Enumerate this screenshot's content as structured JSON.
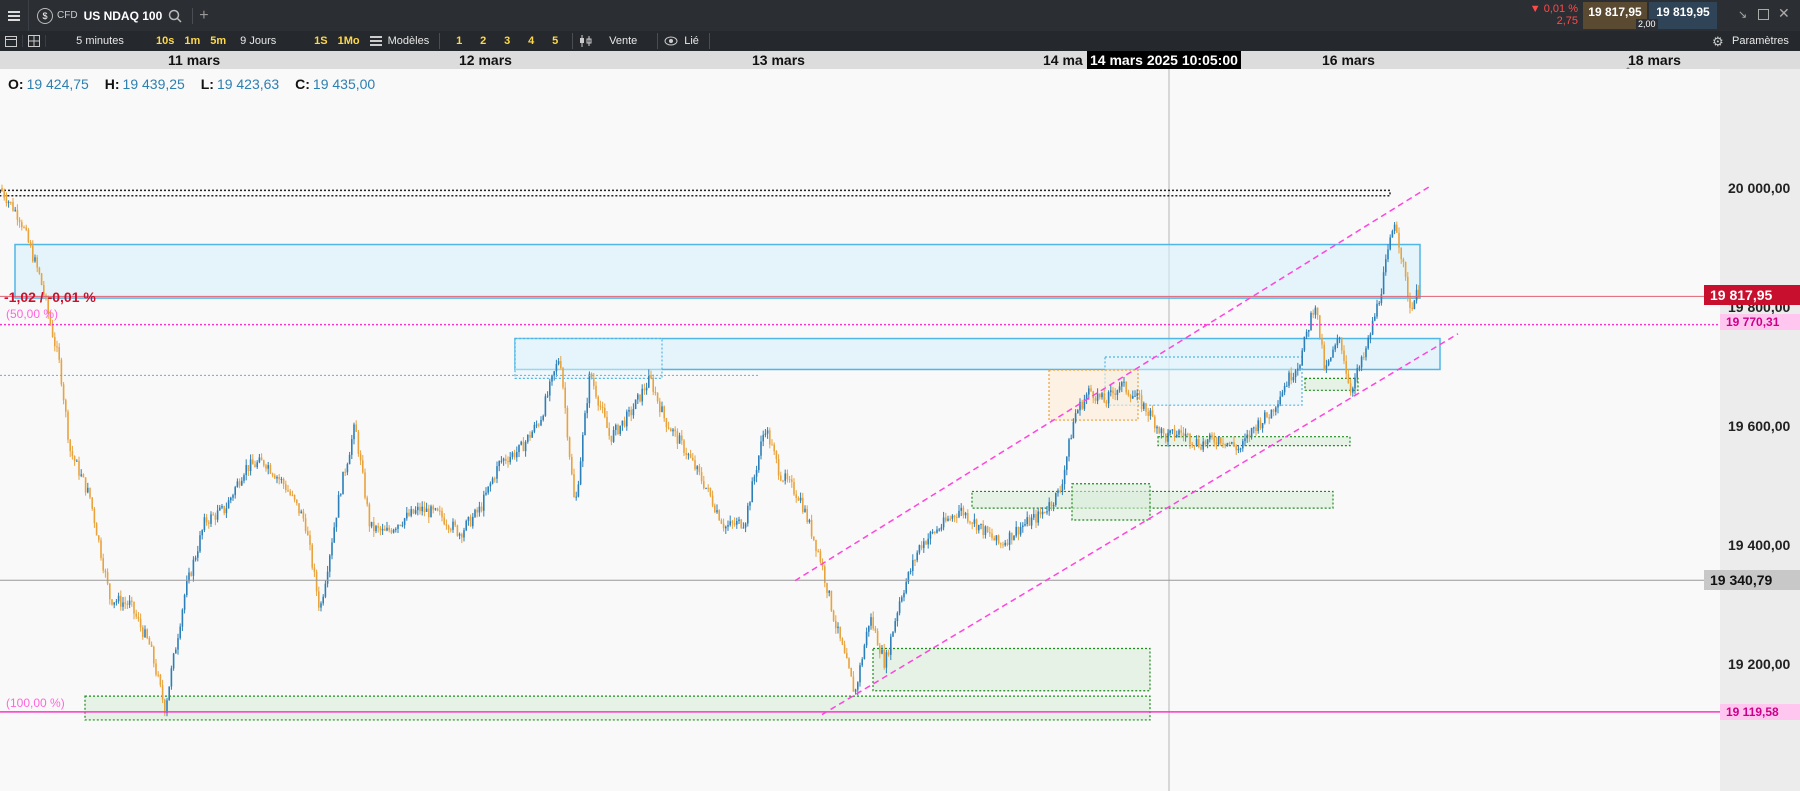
{
  "header": {
    "instrument_type": "CFD",
    "instrument_name": "US NDAQ 100",
    "change_pct": "▼ 0,01 %",
    "change_abs": "2,75",
    "bid": "19 817,95",
    "ask": "19 819,95",
    "spread": "2,00"
  },
  "toolbar": {
    "interval": "5 minutes",
    "intervals_short": [
      "10s",
      "1m",
      "5m"
    ],
    "range": "9 Jours",
    "intervals_long": [
      "1S",
      "1Mo"
    ],
    "models_label": "Modèles",
    "layouts": [
      "1",
      "2",
      "3",
      "4",
      "5"
    ],
    "side_label": "Vente",
    "link_label": "Lié",
    "settings_label": "Paramètres"
  },
  "ohlc": {
    "o_label": "O:",
    "o": "19 424,75",
    "h_label": "H:",
    "h": "19 439,25",
    "l_label": "L:",
    "l": "19 423,63",
    "c_label": "C:",
    "c": "19 435,00"
  },
  "crosshair_time": "14 mars 2025 10:05:00",
  "annotations": {
    "change_label": "-1,02 / -0,01 %",
    "fib_50": "(50,00 %)",
    "fib_100": "(100,00 %)"
  },
  "colors": {
    "up": "#2c7fb8",
    "down": "#e8a33d",
    "current_price_bg": "#c8102e",
    "fib_line": "#ff33cc",
    "zone_blue_border": "#4fb6e6",
    "zone_green_border": "#1e8c1e",
    "zone_orange_border": "#f0a030",
    "channel": "#ff44dd"
  },
  "chart_data": {
    "type": "candlestick",
    "timeframe": "5 minutes",
    "x_labels": [
      "11 mars",
      "12 mars",
      "13 mars",
      "14 ma",
      "16 mars",
      "18 mars"
    ],
    "y_ticks": [
      19200,
      19400,
      19600,
      19800,
      20000
    ],
    "y_tick_labels": [
      "19 200,00",
      "19 400,00",
      "19 600,00",
      "19 800,00",
      "20 000,00"
    ],
    "ylim": [
      18980,
      20100
    ],
    "current_price": {
      "value": 19817.95,
      "label": "19 817,95"
    },
    "fib_50": {
      "value": 19770.31,
      "label": "19 770,31"
    },
    "fib_100": {
      "value": 19119.58,
      "label": "19 119,58"
    },
    "hline_grey": {
      "value": 19340.79,
      "label": "19 340,79"
    },
    "black_zone": {
      "x": [
        0,
        1390
      ],
      "y": [
        19987,
        19996
      ]
    },
    "path_x": [
      0,
      20,
      40,
      60,
      70,
      90,
      110,
      130,
      150,
      165,
      185,
      205,
      225,
      245,
      265,
      285,
      305,
      320,
      340,
      355,
      370,
      385,
      400,
      420,
      440,
      460,
      480,
      500,
      520,
      540,
      560,
      575,
      590,
      610,
      630,
      650,
      665,
      685,
      705,
      725,
      745,
      765,
      780,
      800,
      820,
      835,
      855,
      870,
      885,
      900,
      920,
      940,
      960,
      980,
      1000,
      1020,
      1040,
      1060,
      1075,
      1090,
      1105,
      1120,
      1135,
      1150,
      1165,
      1180,
      1200,
      1220,
      1240,
      1255,
      1270,
      1285,
      1300,
      1315,
      1325,
      1340,
      1350,
      1365,
      1380,
      1395,
      1410,
      1420
    ],
    "path_y": [
      20000,
      19950,
      19850,
      19700,
      19560,
      19480,
      19310,
      19300,
      19230,
      19125,
      19320,
      19440,
      19460,
      19530,
      19540,
      19500,
      19440,
      19290,
      19490,
      19600,
      19430,
      19420,
      19440,
      19460,
      19450,
      19420,
      19460,
      19540,
      19560,
      19610,
      19720,
      19460,
      19690,
      19580,
      19620,
      19680,
      19610,
      19560,
      19500,
      19430,
      19440,
      19600,
      19520,
      19480,
      19380,
      19270,
      19150,
      19280,
      19200,
      19310,
      19400,
      19430,
      19460,
      19430,
      19400,
      19430,
      19450,
      19490,
      19620,
      19660,
      19640,
      19670,
      19650,
      19620,
      19580,
      19590,
      19570,
      19580,
      19560,
      19600,
      19620,
      19670,
      19710,
      19810,
      19690,
      19750,
      19660,
      19720,
      19820,
      19950,
      19800,
      19830
    ],
    "zones_blue": [
      {
        "x": [
          15,
          1420
        ],
        "y": [
          19815,
          19905
        ]
      },
      {
        "x": [
          515,
          1440
        ],
        "y": [
          19695,
          19747
        ]
      }
    ],
    "zones_blue_dotted": [
      {
        "x": [
          515,
          662
        ],
        "y": [
          19680,
          19747
        ]
      },
      {
        "x": [
          1105,
          1302
        ],
        "y": [
          19635,
          19716
        ]
      }
    ],
    "zones_green": [
      {
        "x": [
          85,
          1150
        ],
        "y": [
          19106,
          19146
        ]
      },
      {
        "x": [
          873,
          1150
        ],
        "y": [
          19155,
          19226
        ]
      },
      {
        "x": [
          972,
          1333
        ],
        "y": [
          19462,
          19490
        ]
      },
      {
        "x": [
          1072,
          1150
        ],
        "y": [
          19442,
          19503
        ]
      },
      {
        "x": [
          1158,
          1350
        ],
        "y": [
          19567,
          19582
        ]
      },
      {
        "x": [
          1305,
          1358
        ],
        "y": [
          19660,
          19680
        ]
      }
    ],
    "zones_orange": [
      {
        "x": [
          1049,
          1138
        ],
        "y": [
          19610,
          19694
        ]
      }
    ],
    "channel_lines": [
      {
        "x": [
          795,
          1432
        ],
        "y": [
          19340,
          20005
        ]
      },
      {
        "x": [
          822,
          1458
        ],
        "y": [
          19115,
          19755
        ]
      }
    ]
  }
}
